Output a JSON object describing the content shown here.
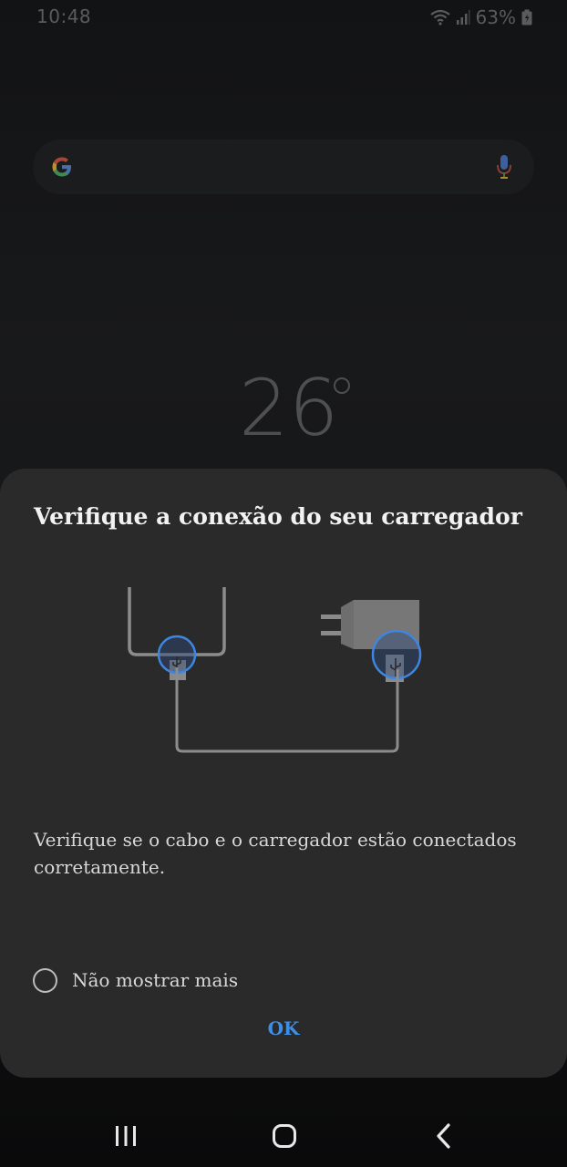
{
  "status_bar": {
    "time": "10:48",
    "battery": "63%",
    "icons": [
      "wifi-icon",
      "signal-icon",
      "battery-icon"
    ]
  },
  "search_bar": {
    "logo": "google-g-icon",
    "mic": "mic-icon"
  },
  "weather": {
    "temperature": "26"
  },
  "dialog": {
    "title": "Verifique a conexão do seu carregador",
    "illustration": "phone-charger-connection-illustration",
    "body": "Verifique se o cabo e o carregador estão conectados corretamente.",
    "checkbox_label": "Não mostrar mais",
    "checkbox_checked": false,
    "ok_label": "OK",
    "accent_color": "#3e8ee6"
  },
  "nav_bar": {
    "recents": "recents-icon",
    "home": "home-icon",
    "back": "back-icon"
  }
}
